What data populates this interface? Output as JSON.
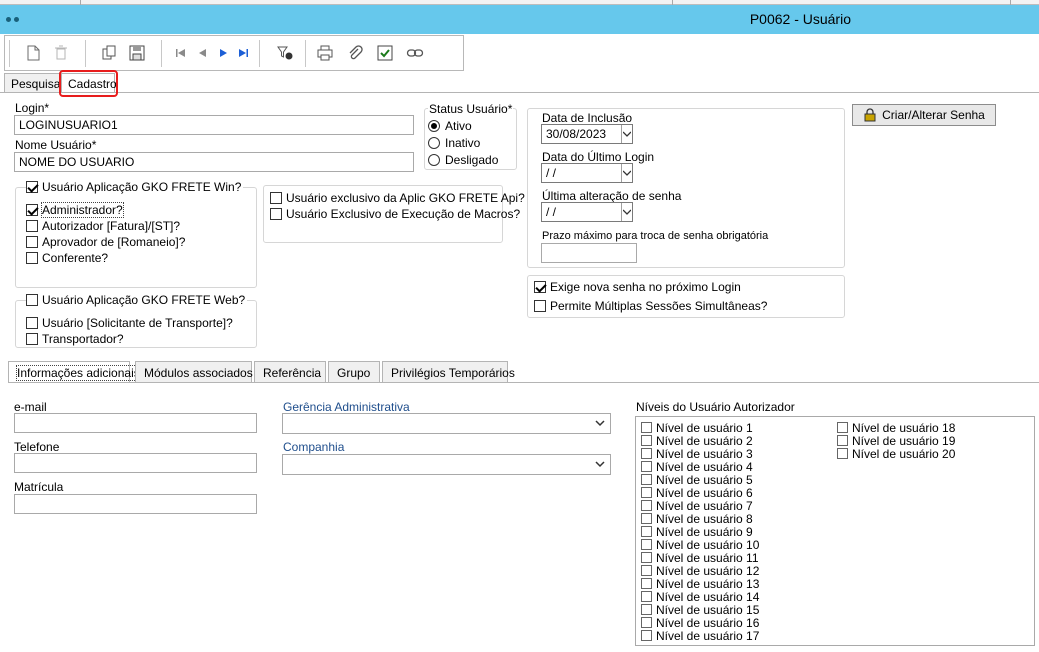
{
  "window": {
    "title": "P0062 - Usuário"
  },
  "toolbar": {
    "icons": [
      "new-document-icon",
      "delete-icon",
      "copy-icon",
      "save-icon",
      "first-record-icon",
      "previous-record-icon",
      "next-record-icon",
      "last-record-icon",
      "search-filter-icon",
      "print-icon",
      "attach-icon",
      "confirm-icon",
      "link-icon"
    ]
  },
  "tabs": {
    "pesquisa": "Pesquisa",
    "cadastro": "Cadastro"
  },
  "form": {
    "login_label": "Login*",
    "login_value": "LOGINUSUARIO1",
    "nome_label": "Nome Usuário*",
    "nome_value": "NOME DO USUARIO"
  },
  "status": {
    "label": "Status Usuário*",
    "ativo": "Ativo",
    "inativo": "Inativo",
    "desligado": "Desligado",
    "selected": "Ativo"
  },
  "win_group": {
    "header": "Usuário Aplicação GKO FRETE Win?",
    "header_checked": true,
    "administrador": "Administrador?",
    "autorizador": "Autorizador [Fatura]/[ST]?",
    "aprovador": "Aprovador de [Romaneio]?",
    "conferente": "Conferente?"
  },
  "api_group": {
    "api": "Usuário exclusivo da Aplic GKO FRETE Api?",
    "macros": "Usuário Exclusivo de Execução de Macros?"
  },
  "web_group": {
    "header": "Usuário Aplicação GKO FRETE Web?",
    "solicitante": "Usuário [Solicitante de Transporte]?",
    "transportador": "Transportador?"
  },
  "dates": {
    "inclusao_label": "Data de Inclusão",
    "inclusao_value": "30/08/2023",
    "ultimo_login_label": "Data do Último Login",
    "ultimo_login_value": " /  /",
    "ultima_alteracao_label": "Última alteração de senha",
    "ultima_alteracao_value": " /  /",
    "prazo_label": "Prazo máximo para troca de senha obrigatória",
    "prazo_value": ""
  },
  "senha_button": "Criar/Alterar Senha",
  "options": {
    "exige_nova_senha": "Exige nova senha no próximo Login",
    "multiplas_sessoes": "Permite Múltiplas Sessões Simultâneas?"
  },
  "subtabs": {
    "info": "Informações adicionais",
    "modulos": "Módulos associados",
    "referencia": "Referência",
    "grupo": "Grupo",
    "privilegios": "Privilégios Temporários"
  },
  "info": {
    "email_label": "e-mail",
    "telefone_label": "Telefone",
    "matricula_label": "Matrícula",
    "gerencia_label": "Gerência Administrativa",
    "companhia_label": "Companhia",
    "niveis_label": "Níveis do Usuário Autorizador"
  },
  "levels": [
    "Nível de usuário 1",
    "Nível de usuário 2",
    "Nível de usuário 3",
    "Nível de usuário 4",
    "Nível de usuário 5",
    "Nível de usuário 6",
    "Nível de usuário 7",
    "Nível de usuário 8",
    "Nível de usuário 9",
    "Nível de usuário 10",
    "Nível de usuário 11",
    "Nível de usuário 12",
    "Nível de usuário 13",
    "Nível de usuário 14",
    "Nível de usuário 15",
    "Nível de usuário 16",
    "Nível de usuário 17",
    "Nível de usuário 18",
    "Nível de usuário 19",
    "Nível de usuário 20"
  ],
  "colors": {
    "titlebar": "#66c8ec",
    "highlight": "#e81d1d",
    "link_label": "#1f4e8c"
  }
}
